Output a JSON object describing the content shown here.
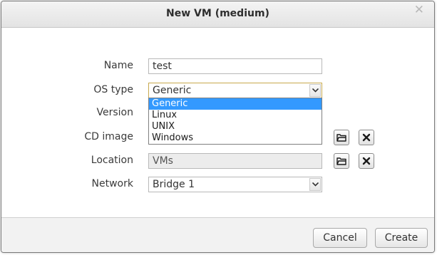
{
  "dialog": {
    "title": "New VM (medium)",
    "close_glyph": "✕"
  },
  "form": {
    "name": {
      "label": "Name",
      "value": "test"
    },
    "os_type": {
      "label": "OS type",
      "selected": "Generic",
      "options": [
        "Generic",
        "Linux",
        "UNIX",
        "Windows"
      ]
    },
    "version": {
      "label": "Version"
    },
    "cd_image": {
      "label": "CD image"
    },
    "location": {
      "label": "Location",
      "value": "VMs"
    },
    "network": {
      "label": "Network",
      "selected": "Bridge 1"
    }
  },
  "icons": {
    "browse": "folder-icon",
    "clear": "close-icon",
    "dropdown": "chevron-down-icon"
  },
  "colors": {
    "dropdown_highlight": "#3399ff",
    "focus_border": "#c8a94d"
  },
  "footer": {
    "cancel_label": "Cancel",
    "create_label": "Create"
  }
}
